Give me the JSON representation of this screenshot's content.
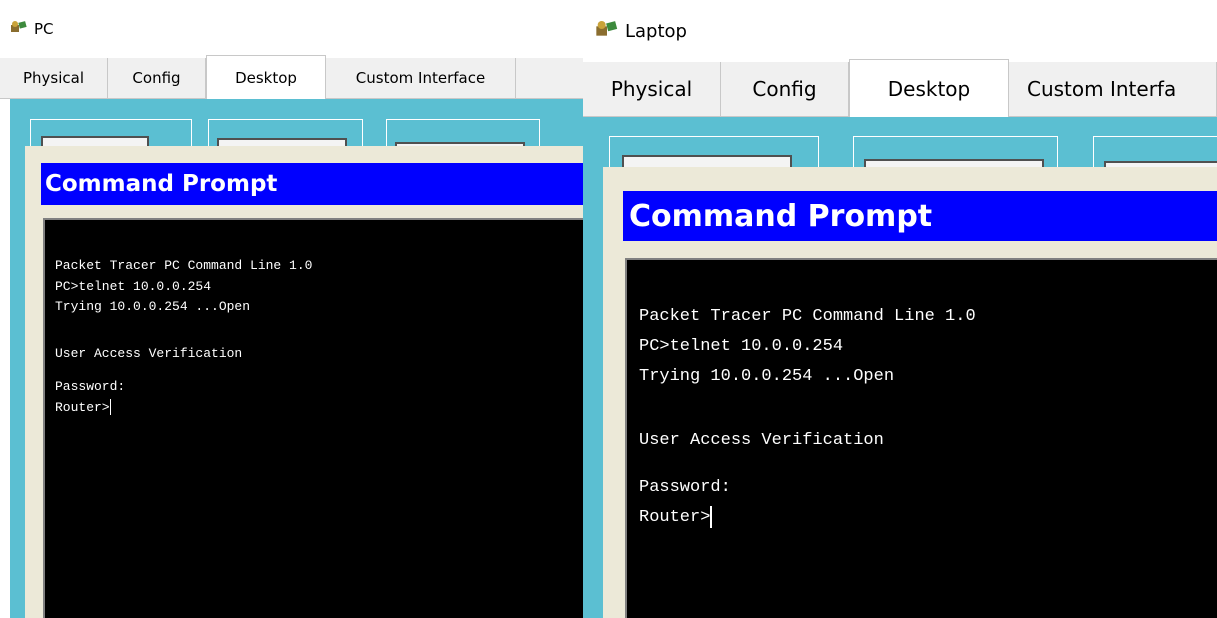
{
  "pc": {
    "title": "PC",
    "tabs": [
      "Physical",
      "Config",
      "Desktop",
      "Custom Interface"
    ],
    "active_tab": "Desktop",
    "app_title": "Command Prompt",
    "terminal_lines": [
      "Packet Tracer PC Command Line 1.0",
      "PC>telnet 10.0.0.254",
      "Trying 10.0.0.254 ...Open",
      "",
      "",
      "User Access Verification",
      "",
      "Password:",
      "Router>"
    ]
  },
  "laptop": {
    "title": "Laptop",
    "tabs": [
      "Physical",
      "Config",
      "Desktop",
      "Custom Interfa"
    ],
    "active_tab": "Desktop",
    "app_title": "Command Prompt",
    "terminal_lines": [
      "Packet Tracer PC Command Line 1.0",
      "PC>telnet 10.0.0.254",
      "Trying 10.0.0.254 ...Open",
      "",
      "",
      "User Access Verification",
      "",
      "Password:",
      "Router>"
    ]
  },
  "colors": {
    "desktop_bg": "#5bbfd2",
    "cmd_title_bg": "#0000ff",
    "terminal_bg": "#000000",
    "terminal_fg": "#ffffff"
  },
  "icons": {
    "window_icon": "packet-tracer-device-icon",
    "desktop_apps": [
      "desktop-app-icon"
    ]
  }
}
